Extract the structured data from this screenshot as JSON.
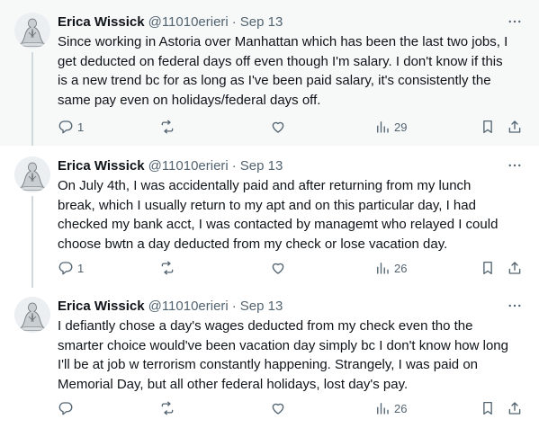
{
  "tweets": [
    {
      "author_name": "Erica Wissick",
      "handle": "@11010erieri",
      "separator": "·",
      "date": "Sep 13",
      "text": "Since working in Astoria over Manhattan which has been the last two jobs, I\nget deducted on federal days off even though I'm salary. I don't know if this\nis a new trend bc for as long as I've been paid salary, it's consistently the\nsame pay even on holidays/federal days off.",
      "replies": "1",
      "views": "29",
      "avatar_icon": "praying-figure-avatar",
      "more_icon": "more-horizontal-icon"
    },
    {
      "author_name": "Erica Wissick",
      "handle": "@11010erieri",
      "separator": "·",
      "date": "Sep 13",
      "text": "On July 4th, I was accidentally paid and after returning from my lunch\nbreak, which I usually return to my apt and on this particular day, I had\nchecked my bank acct, I was contacted by managemt who relayed I could\nchoose bwtn a day deducted from my check or lose vacation day.",
      "replies": "1",
      "views": "26",
      "avatar_icon": "praying-figure-avatar",
      "more_icon": "more-horizontal-icon"
    },
    {
      "author_name": "Erica Wissick",
      "handle": "@11010erieri",
      "separator": "·",
      "date": "Sep 13",
      "text": "I defiantly chose a day's wages deducted from my check even tho the\nsmarter choice would've been vacation day simply bc I don't know how long\nI'll be at job w terrorism constantly happening. Strangely, I was paid on\nMemorial Day, but all other federal holidays, lost day's pay.",
      "replies": "",
      "views": "26",
      "avatar_icon": "praying-figure-avatar",
      "more_icon": "more-horizontal-icon"
    }
  ],
  "action_icons": [
    "reply-icon",
    "retweet-icon",
    "like-icon",
    "views-icon",
    "bookmark-icon",
    "share-icon"
  ],
  "colors": {
    "text_primary": "#0f1419",
    "text_secondary": "#536471",
    "highlight_background": "#f7f9f9",
    "thread_line": "#cfd9de"
  }
}
